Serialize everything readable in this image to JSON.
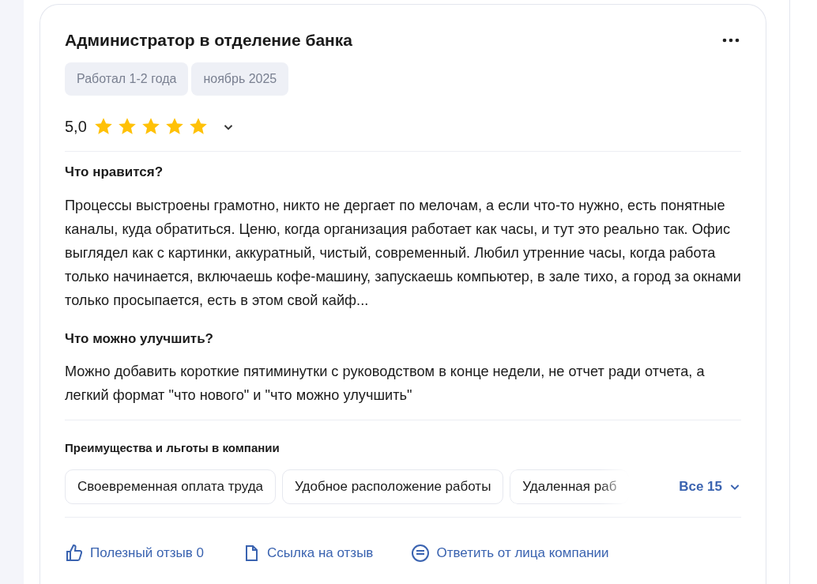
{
  "review": {
    "title": "Администратор в отделение банка",
    "tags": [
      "Работал 1-2 года",
      "ноябрь 2025"
    ],
    "rating": "5,0",
    "stars": 5,
    "sections": [
      {
        "heading": "Что нравится?",
        "text": "Процессы выстроены грамотно, никто не дергает по мелочам, а если что-то нужно, есть понятные каналы, куда обратиться. Ценю, когда организация работает как часы, и тут это реально так. Офис выглядел как с картинки, аккуратный, чистый, современный. Любил утренние часы, когда работа только начинается, включаешь кофе-машину, запускаешь компьютер, в зале тихо, а город за окнами только просыпается, есть в этом свой кайф..."
      },
      {
        "heading": "Что можно улучшить?",
        "text": "Можно добавить короткие пятиминутки с руководством в конце недели, не отчет ради отчета, а легкий формат \"что нового\" и \"что можно улучшить\""
      }
    ],
    "benefits_heading": "Преимущества и льготы в компании",
    "benefits": [
      "Своевременная оплата труда",
      "Удобное расположение работы",
      "Удаленная раб"
    ],
    "benefits_more": "Все 15",
    "actions": [
      {
        "kind": "like",
        "label": "Полезный отзыв 0"
      },
      {
        "kind": "link",
        "label": "Ссылка на отзыв"
      },
      {
        "kind": "reply",
        "label": "Ответить от лица компании"
      }
    ]
  }
}
